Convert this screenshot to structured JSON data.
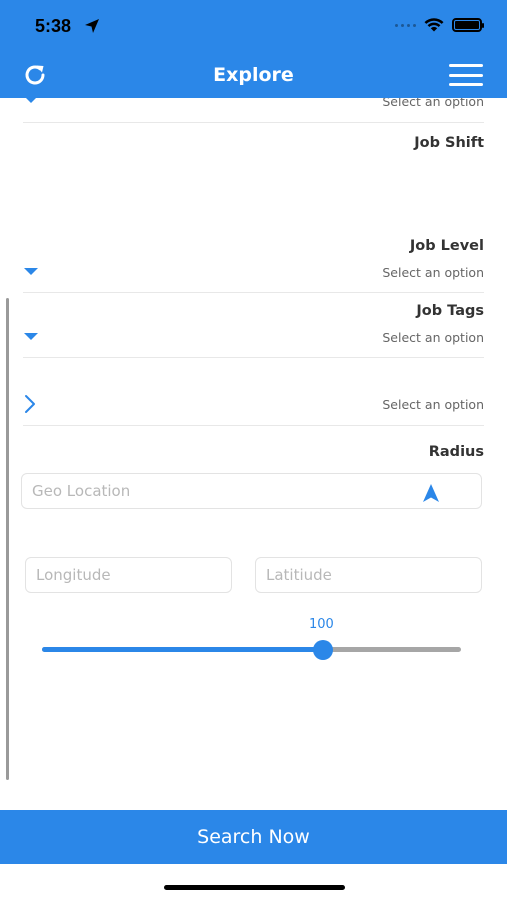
{
  "status_bar": {
    "time": "5:38"
  },
  "header": {
    "title": "Explore"
  },
  "filters": {
    "top_select_value": "Select an option",
    "job_shift_label": "Job Shift",
    "job_level_label": "Job Level",
    "job_level_value": "Select an option",
    "job_tags_label": "Job Tags",
    "job_tags_value": "Select an option",
    "unnamed_select_value": "Select an option",
    "radius_label": "Radius"
  },
  "inputs": {
    "geo_location_placeholder": "Geo Location",
    "longitude_placeholder": "Longitude",
    "latitude_placeholder": "Latitiude"
  },
  "slider": {
    "value": "100",
    "fraction": 0.67
  },
  "footer": {
    "search_label": "Search Now"
  },
  "colors": {
    "accent": "#2b87e8"
  }
}
